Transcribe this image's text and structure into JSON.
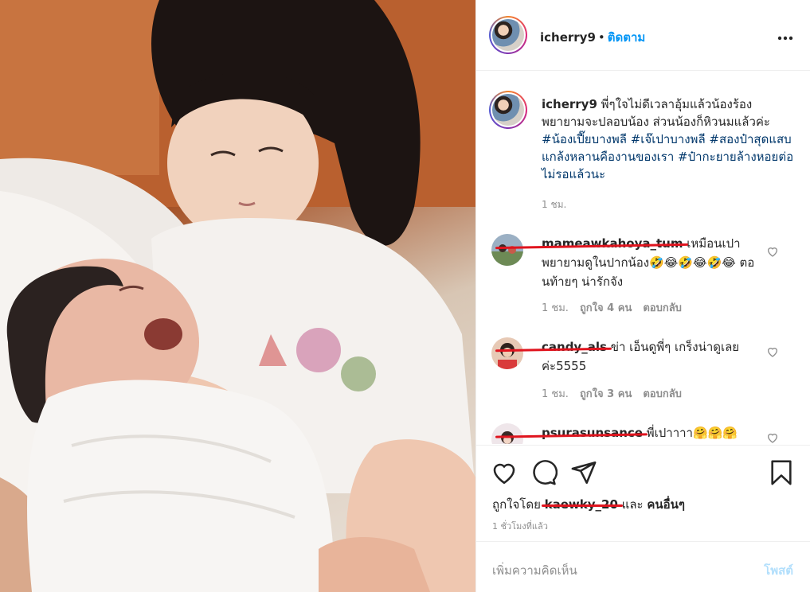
{
  "post": {
    "username": "icherry9",
    "follow_label": "ติดตาม",
    "more_icon": "more-options-icon"
  },
  "caption": {
    "username": "icherry9",
    "text": " พี่ๆใจไม่ดีเวลาอุ้มแล้วน้องร้อง พยายามจะปลอบน้อง ส่วนน้องก็หิวนมแล้วค่ะ ",
    "hashtags": [
      "#น้องเปี๊ยบางพลี",
      "#เจ๊เปาบางพลี",
      "#สองป๋าสุดแสบแกล้งหลานคืองานของเรา",
      "#ป๋ากะยายล้างหอยต่อไม่รอแล้วนะ"
    ],
    "time": "1 ชม."
  },
  "comments": [
    {
      "username": "mameawkahoya_tum",
      "text": "เหมือนเปา พยายามดูในปากน้อง🤣😂🤣😂🤣😂 ตอนท้ายๆ น่ารักจัง",
      "time": "1 ชม.",
      "likes": "ถูกใจ 4 คน",
      "reply": "ตอบกลับ"
    },
    {
      "username": "candy_als",
      "text": "ข่า เอ็นดูพี่ๆ เกร็งน่าดูเลยค่ะ5555",
      "time": "1 ชม.",
      "likes": "ถูกใจ 3 คน",
      "reply": "ตอบกลับ"
    },
    {
      "username": "psurasunsance",
      "text": "พี่เปาาาา🤗🤗🤗",
      "time": "",
      "likes": "",
      "reply": ""
    }
  ],
  "liked_by": {
    "prefix": "ถูกใจโดย ",
    "user": "kaewky_20",
    "middle": " และ ",
    "others": "คนอื่นๆ"
  },
  "time_ago": "1 ชั่วโมงที่แล้ว",
  "add_comment": {
    "placeholder": "เพิ่มความคิดเห็น",
    "post_label": "โพสต์"
  },
  "colors": {
    "link_blue": "#0095f6",
    "hashtag": "#00376b",
    "muted": "#8e8e8e",
    "redaction": "#e0141e"
  }
}
